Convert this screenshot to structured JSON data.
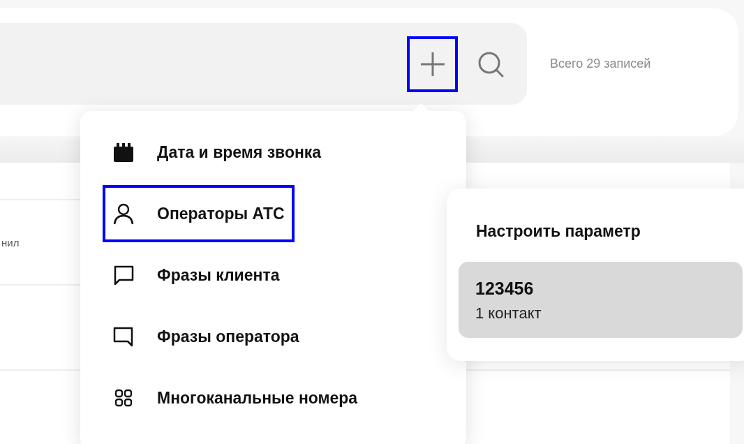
{
  "toolbar": {
    "add_button": {
      "highlighted": true
    },
    "count": "Всего 29 записей"
  },
  "table": {
    "rows": [
      {
        "column_1": ""
      },
      {
        "column_1": "нил"
      },
      {
        "column_1": ""
      }
    ]
  },
  "add_menu": {
    "items": [
      {
        "kind": "calendar",
        "label": "Дата и время звонка",
        "highlighted": false
      },
      {
        "kind": "person",
        "label": "Операторы АТС",
        "highlighted": true
      },
      {
        "kind": "bubble-left",
        "label": "Фразы клиента",
        "highlighted": false
      },
      {
        "kind": "bubble-right",
        "label": "Фразы оператора",
        "highlighted": false
      },
      {
        "kind": "grid",
        "label": "Многоканальные номера",
        "highlighted": false
      }
    ]
  },
  "parameter_popup": {
    "title": "Настроить параметр",
    "options": [
      {
        "name": "123456",
        "detail": "1 контакт",
        "selected": true
      }
    ]
  }
}
